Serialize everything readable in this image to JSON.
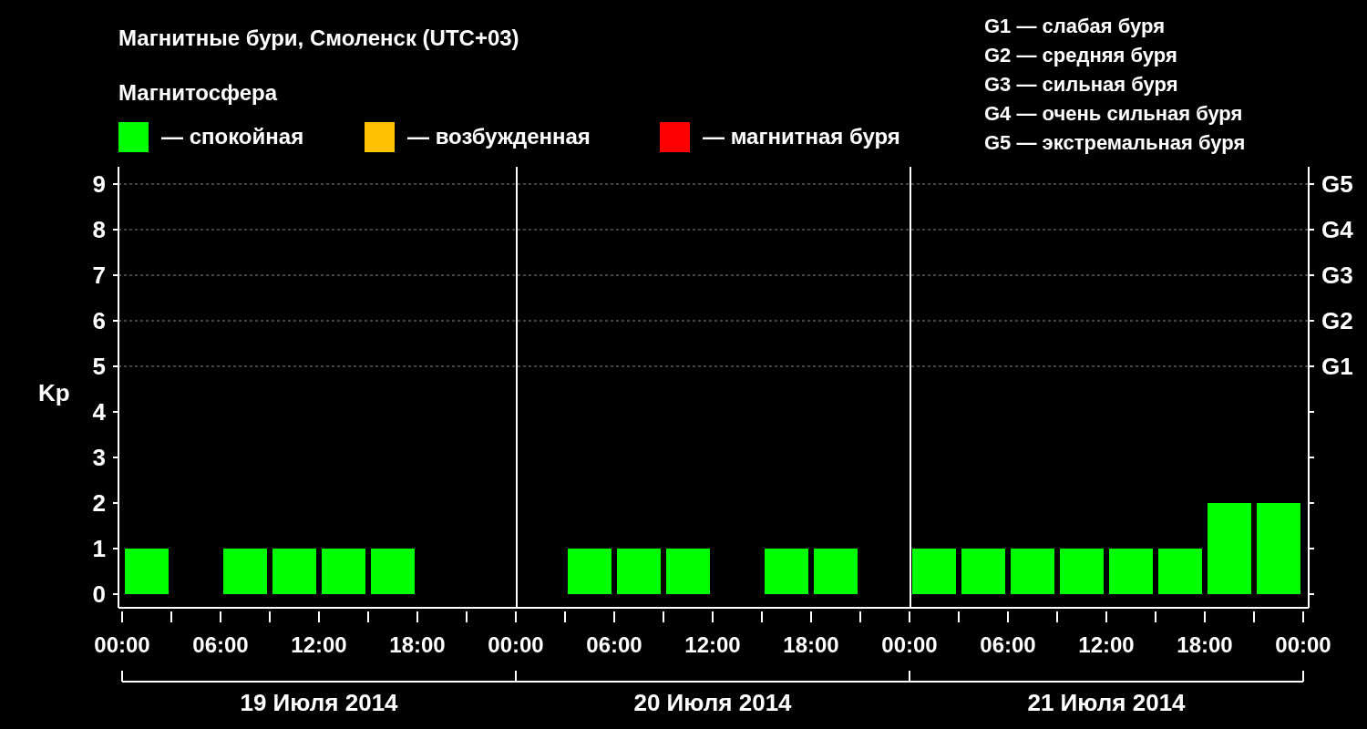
{
  "title": "Магнитные бури, Смоленск (UTC+03)",
  "subtitle": "Магнитосфера",
  "legend": [
    {
      "color": "#00ff00",
      "label": "— спокойная"
    },
    {
      "color": "#ffc000",
      "label": "— возбужденная"
    },
    {
      "color": "#ff0000",
      "label": "— магнитная буря"
    }
  ],
  "storm_scale": [
    "G1 — слабая буря",
    "G2 — средняя буря",
    "G3 — сильная буря",
    "G4 — очень сильная буря",
    "G5 — экстремальная буря"
  ],
  "days": [
    {
      "label": "19 Июля 2014"
    },
    {
      "label": "20 Июля 2014"
    },
    {
      "label": "21 Июля 2014"
    }
  ],
  "chart_data": {
    "type": "bar",
    "ylabel": "Kp",
    "categories": [
      null,
      null,
      null,
      null,
      null,
      null,
      null,
      null,
      null,
      null,
      null,
      null,
      null,
      null,
      null,
      null,
      null,
      null,
      null,
      null,
      null,
      null,
      null,
      null
    ],
    "grid": true,
    "series": [
      {
        "color": "#00ff00",
        "values": [
          1,
          null,
          1,
          1,
          1,
          1,
          null,
          null,
          null,
          1,
          1,
          1,
          null,
          1,
          1,
          null,
          1,
          1,
          1,
          1,
          1,
          1,
          2,
          2
        ]
      }
    ],
    "ylim": [
      -0.3,
      9.38
    ],
    "yticks": [
      0,
      1,
      2,
      3,
      4,
      5,
      6,
      7,
      8,
      9
    ]
  },
  "time_labels": [
    "00:00",
    "06:00",
    "12:00",
    "18:00",
    "00:00",
    "06:00",
    "12:00",
    "18:00",
    "00:00",
    "06:00",
    "12:00",
    "18:00",
    "00:00"
  ],
  "storm_levels": [
    "G5",
    "G4",
    "G3",
    "G2",
    "G1"
  ]
}
